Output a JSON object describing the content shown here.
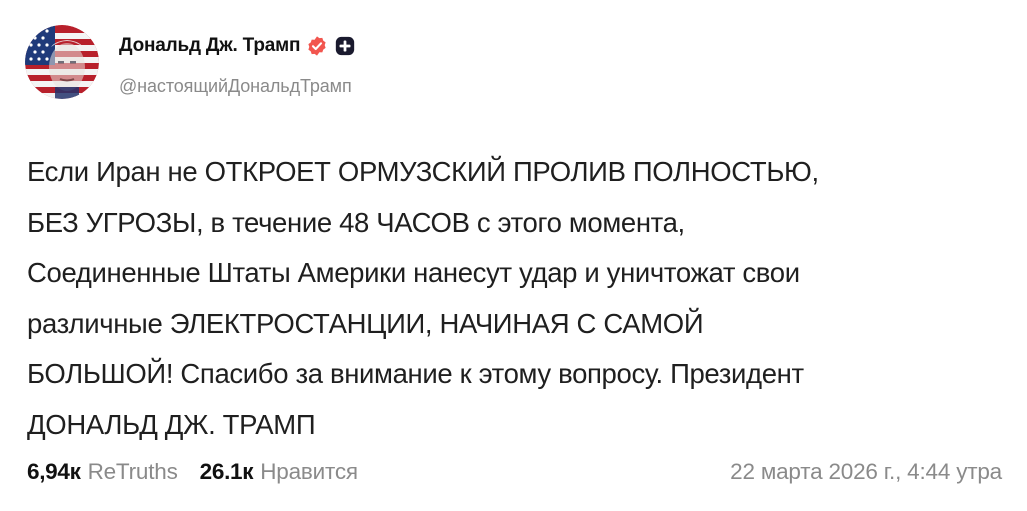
{
  "author": {
    "display_name": "Дональд Дж. Трамп",
    "handle": "@настоящийДональдТрамп",
    "avatar_icon": "profile-avatar",
    "verified_icon": "verified-badge-icon",
    "verified_color": "#f2564f",
    "extra_badge_icon": "plus-badge-icon",
    "extra_badge_color": "#1a1a2e"
  },
  "post": {
    "lines": [
      "Если Иран не ОТКРОЕТ ОРМУЗСКИЙ ПРОЛИВ ПОЛНОСТЬЮ,",
      "БЕЗ УГРОЗЫ, в течение 48 ЧАСОВ с этого момента,",
      "Соединенные Штаты Америки нанесут удар и уничтожат свои",
      "различные ЭЛЕКТРОСТАНЦИИ, НАЧИНАЯ С САМОЙ",
      "БОЛЬШОЙ! Спасибо за внимание к этому вопросу. Президент",
      "ДОНАЛЬД ДЖ. ТРАМП"
    ]
  },
  "stats": {
    "retruths_count": "6,94к",
    "retruths_label": "ReTruths",
    "likes_count": "26.1к",
    "likes_label": "Нравится"
  },
  "timestamp": "22 марта 2026 г., 4:44 утра"
}
